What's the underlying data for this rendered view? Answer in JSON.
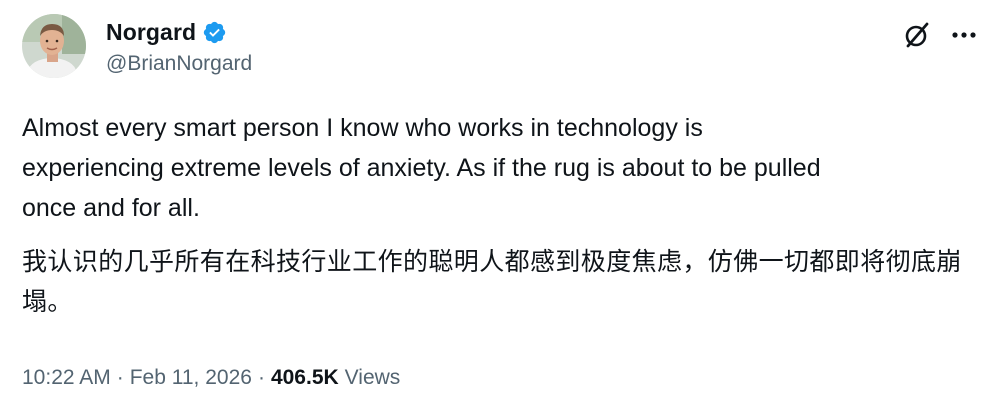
{
  "author": {
    "display_name": "Norgard",
    "handle": "@BrianNorgard",
    "verified": true,
    "avatar_icon": "profile-photo"
  },
  "header_actions": [
    {
      "name": "grok-icon"
    },
    {
      "name": "more-options-icon"
    }
  ],
  "tweet": {
    "text_en": "Almost every smart person I know who works in technology is\nexperiencing extreme levels of anxiety. As if the rug is about to be pulled\nonce and for all.",
    "text_zh": "我认识的几乎所有在科技行业工作的聪明人都感到极度焦虑，仿佛一切都即将彻底崩塌。"
  },
  "meta": {
    "time": "10:22 AM",
    "separator": "·",
    "date": "Feb 11, 2026",
    "views_count": "406.5K",
    "views_label": "Views"
  },
  "colors": {
    "text_primary": "#0f1419",
    "text_secondary": "#536471",
    "verified_blue": "#1d9bf0",
    "background": "#ffffff"
  }
}
